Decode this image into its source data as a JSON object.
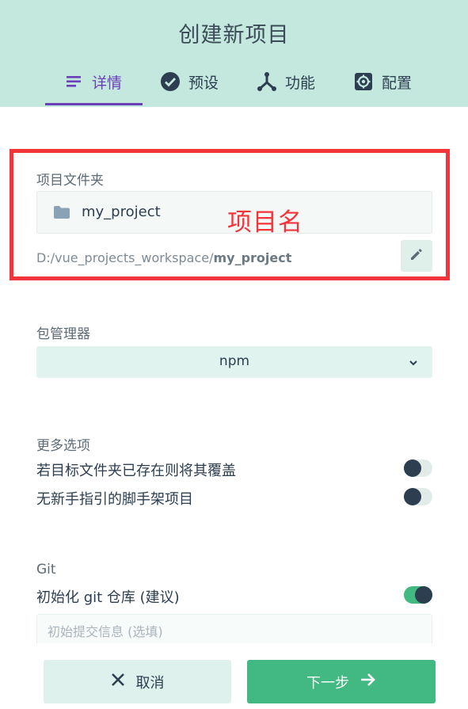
{
  "header": {
    "title": "创建新项目",
    "tabs": [
      {
        "label": "详情",
        "icon": "list-icon",
        "active": true
      },
      {
        "label": "预设",
        "icon": "check-circle-icon",
        "active": false
      },
      {
        "label": "功能",
        "icon": "call-split-icon",
        "active": false
      },
      {
        "label": "配置",
        "icon": "settings-icon",
        "active": false
      }
    ]
  },
  "folder": {
    "label": "项目文件夹",
    "value": "my_project",
    "path_prefix": "D:/vue_projects_workspace/",
    "path_name": "my_project",
    "annotation": "项目名"
  },
  "package_manager": {
    "label": "包管理器",
    "selected": "npm"
  },
  "more_options": {
    "label": "更多选项",
    "items": [
      {
        "label": "若目标文件夹已存在则将其覆盖",
        "enabled": false
      },
      {
        "label": "无新手指引的脚手架项目",
        "enabled": false
      }
    ]
  },
  "git": {
    "label": "Git",
    "init_label": "初始化 git 仓库 (建议)",
    "init_enabled": true,
    "commit_placeholder": "初始提交信息 (选填)"
  },
  "footer": {
    "cancel_label": "取消",
    "next_label": "下一步"
  },
  "colors": {
    "header_bg": "#c4e8de",
    "accent_purple": "#6a3fb8",
    "primary_green": "#42b983",
    "annotation_red": "#f2353b"
  }
}
